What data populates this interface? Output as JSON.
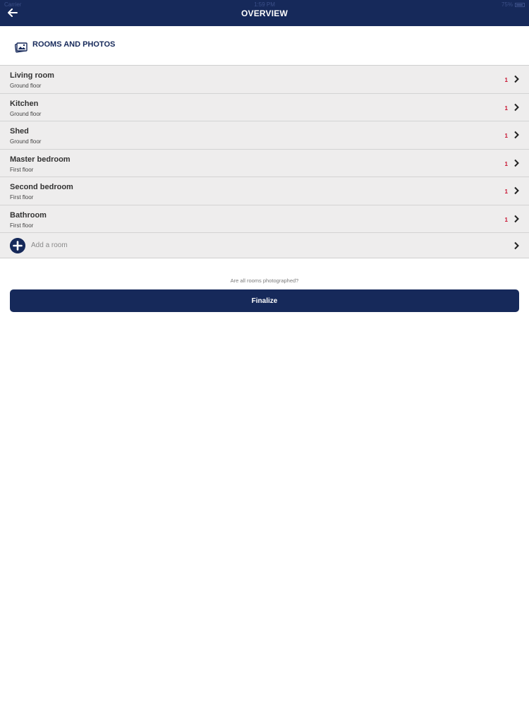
{
  "status_bar": {
    "carrier": "Carrier",
    "time": "1:59 PM",
    "battery": "75%"
  },
  "header": {
    "title": "OVERVIEW",
    "back_icon": "arrow-left-icon"
  },
  "section": {
    "title": "ROOMS AND PHOTOS",
    "icon": "photos-icon"
  },
  "rooms": [
    {
      "name": "Living room",
      "floor": "Ground floor",
      "photo_count": "1"
    },
    {
      "name": "Kitchen",
      "floor": "Ground floor",
      "photo_count": "1"
    },
    {
      "name": "Shed",
      "floor": "Ground floor",
      "photo_count": "1"
    },
    {
      "name": "Master bedroom",
      "floor": "First floor",
      "photo_count": "1"
    },
    {
      "name": "Second bedroom",
      "floor": "First floor",
      "photo_count": "1"
    },
    {
      "name": "Bathroom",
      "floor": "First floor",
      "photo_count": "1"
    }
  ],
  "add_room": {
    "label": "Add a room",
    "icon": "plus-circle-icon"
  },
  "footer": {
    "prompt": "Are all rooms photographed?",
    "finalize_label": "Finalize"
  },
  "colors": {
    "brand": "#16295a",
    "row_background": "#eeeded",
    "count": "#c8102e"
  }
}
